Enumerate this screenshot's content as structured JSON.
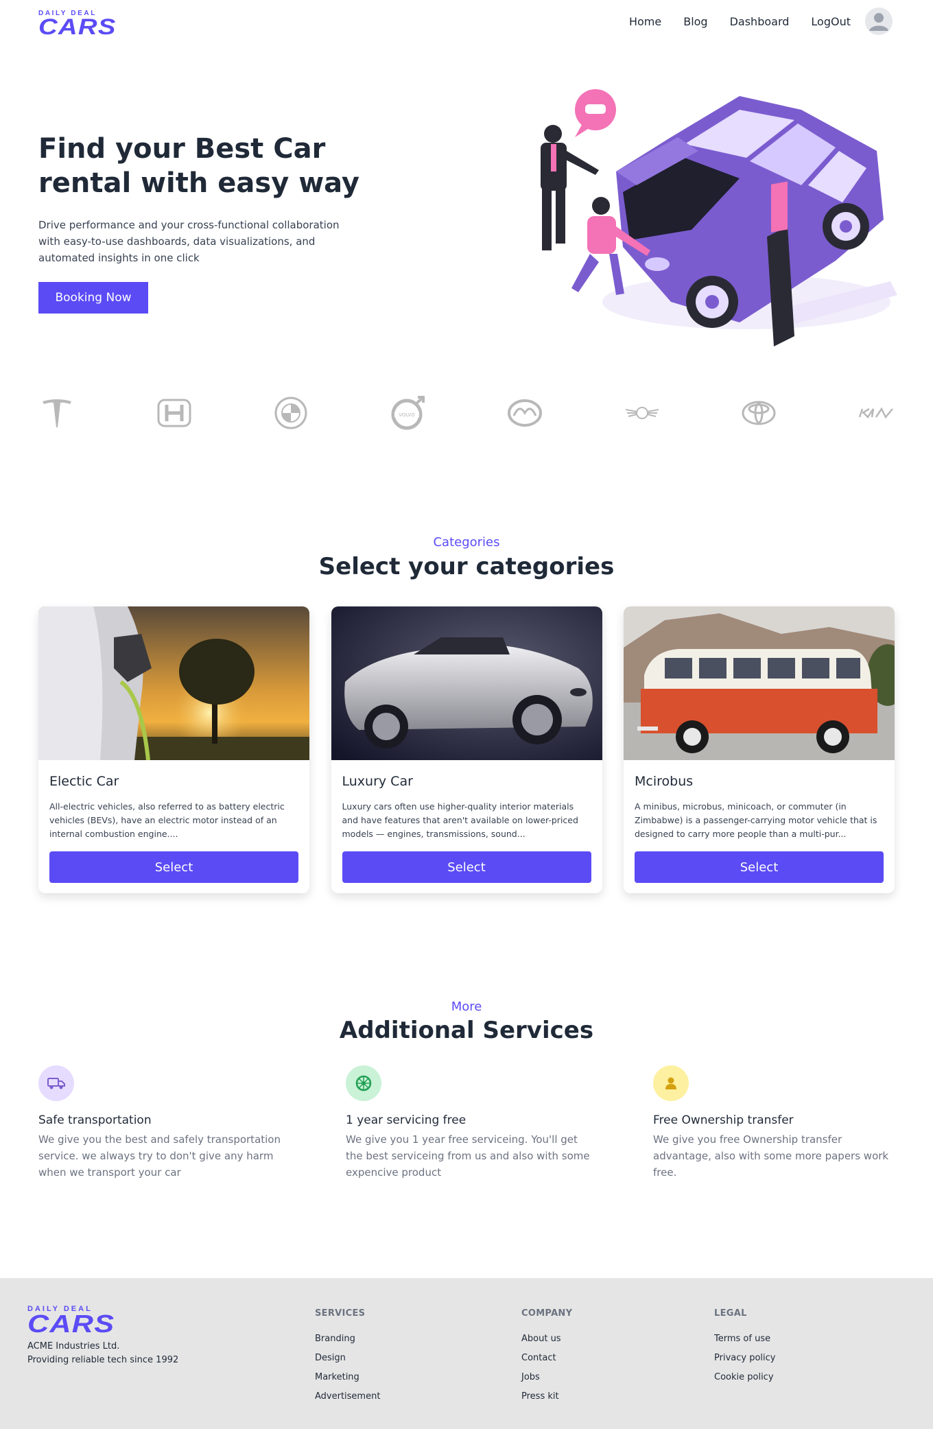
{
  "brand": {
    "logo_top": "DAILY DEAL",
    "logo_main": "CARS",
    "accent_color": "#5b4bf5"
  },
  "nav": {
    "links": [
      "Home",
      "Blog",
      "Dashboard",
      "LogOut"
    ],
    "avatar_icon": "user-avatar-icon"
  },
  "hero": {
    "title": "Find your Best Car rental with easy way",
    "description": "Drive performance and your cross-functional collaboration with easy-to-use dashboards, data visualizations, and automated insights in one click",
    "cta_label": "Booking Now"
  },
  "brands": [
    "tesla-logo-icon",
    "honda-logo-icon",
    "bmw-logo-icon",
    "volvo-logo-icon",
    "mazda-logo-icon",
    "mini-logo-icon",
    "toyota-logo-icon",
    "kia-logo-icon"
  ],
  "categories": {
    "eyebrow": "Categories",
    "title": "Select your categories",
    "cards": [
      {
        "title": "Electic Car",
        "text": "All-electric vehicles, also referred to as battery electric vehicles (BEVs), have an electric motor instead of an internal combustion engine....",
        "button": "Select"
      },
      {
        "title": "Luxury Car",
        "text": "Luxury cars often use higher-quality interior materials and have features that aren't available on lower-priced models — engines, transmissions, sound...",
        "button": "Select"
      },
      {
        "title": "Mcirobus",
        "text": "A minibus, microbus, minicoach, or commuter (in Zimbabwe) is a passenger-carrying motor vehicle that is designed to carry more people than a multi-pur...",
        "button": "Select"
      }
    ]
  },
  "services": {
    "eyebrow": "More",
    "title": "Additional Services",
    "items": [
      {
        "icon": "truck-icon",
        "title": "Safe transportation",
        "text": "We give you the best and safely transportation service. we always try to don't give any harm when we transport your car"
      },
      {
        "icon": "wheel-icon",
        "title": "1 year servicing free",
        "text": "We give you 1 year free serviceing. You'll get the best serviceing from us and also with some expencive product"
      },
      {
        "icon": "person-icon",
        "title": "Free Ownership transfer",
        "text": "We give you free Ownership transfer advantage, also with some more papers work free."
      }
    ]
  },
  "footer": {
    "company_line1": "ACME Industries Ltd.",
    "company_line2": "Providing reliable tech since 1992",
    "columns": [
      {
        "heading": "SERVICES",
        "links": [
          "Branding",
          "Design",
          "Marketing",
          "Advertisement"
        ]
      },
      {
        "heading": "COMPANY",
        "links": [
          "About us",
          "Contact",
          "Jobs",
          "Press kit"
        ]
      },
      {
        "heading": "LEGAL",
        "links": [
          "Terms of use",
          "Privacy policy",
          "Cookie policy"
        ]
      }
    ]
  }
}
